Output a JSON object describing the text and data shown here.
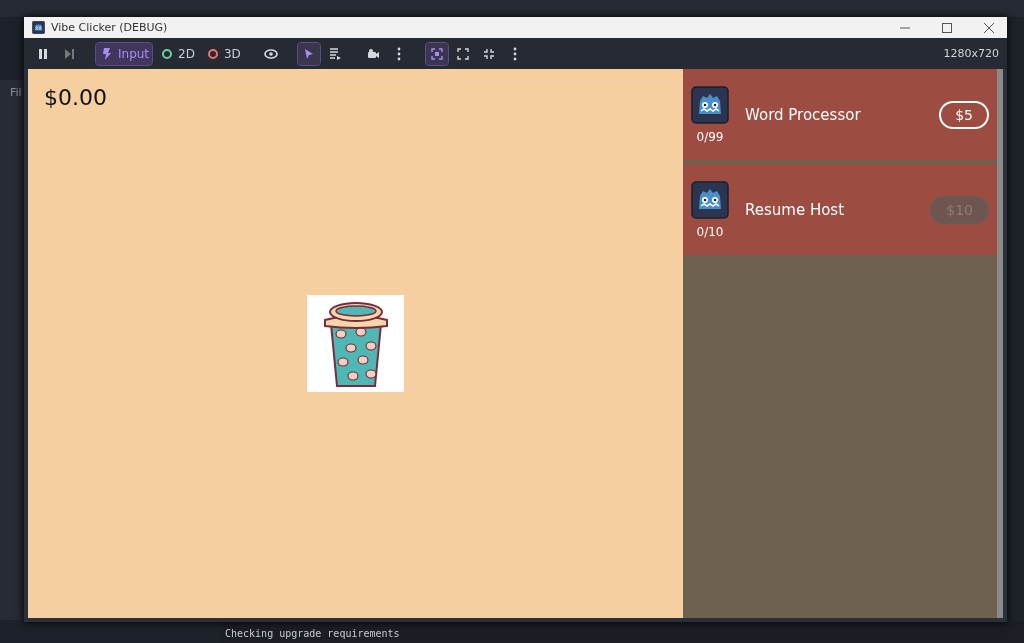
{
  "editor": {
    "left_dock_label": "Fil",
    "console_line": "Checking upgrade requirements"
  },
  "window": {
    "title": "Vibe Clicker (DEBUG)"
  },
  "toolbar": {
    "items": [
      {
        "kind": "pause",
        "selected": false
      },
      {
        "kind": "step",
        "selected": false
      },
      {
        "kind": "input",
        "label": "Input",
        "selected": true
      },
      {
        "kind": "flat",
        "label": "2D",
        "selected": false
      },
      {
        "kind": "spatial",
        "label": "3D",
        "selected": false
      },
      {
        "kind": "eye",
        "selected": false
      },
      {
        "kind": "pointer",
        "selected": true
      },
      {
        "kind": "list",
        "selected": false
      },
      {
        "kind": "camera",
        "selected": false
      },
      {
        "kind": "more",
        "selected": false
      },
      {
        "kind": "frame",
        "selected": true
      },
      {
        "kind": "expand",
        "selected": false
      },
      {
        "kind": "shrink",
        "selected": false
      },
      {
        "kind": "more",
        "selected": false
      }
    ],
    "resolution": "1280x720"
  },
  "game": {
    "money": "$0.00",
    "upgrades": [
      {
        "name": "Word Processor",
        "count": "0/99",
        "price": "$5",
        "affordable": true
      },
      {
        "name": "Resume Host",
        "count": "0/10",
        "price": "$10",
        "affordable": false
      }
    ]
  }
}
